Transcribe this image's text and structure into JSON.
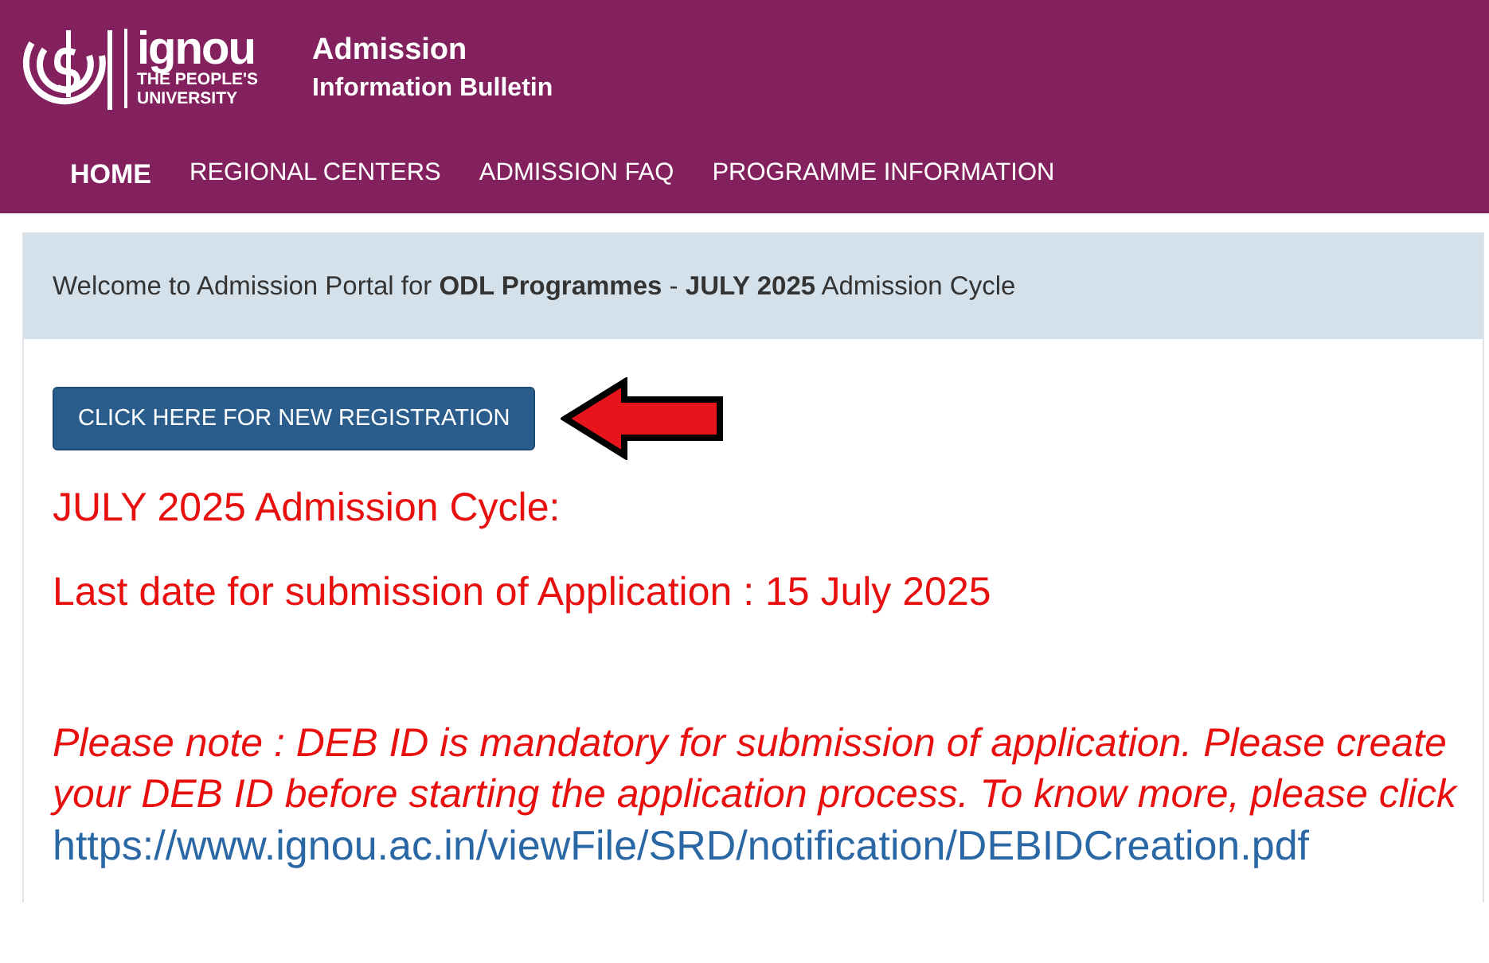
{
  "logo": {
    "name": "ignou",
    "tagline_1": "THE PEOPLE'S",
    "tagline_2": "UNIVERSITY"
  },
  "site_title": {
    "line_1": "Admission",
    "line_2": "Information Bulletin"
  },
  "nav": [
    {
      "label": "HOME",
      "selected": true
    },
    {
      "label": "REGIONAL CENTERS",
      "selected": false
    },
    {
      "label": "ADMISSION FAQ",
      "selected": false
    },
    {
      "label": "PROGRAMME INFORMATION",
      "selected": false
    }
  ],
  "welcome": "Welcome to Admission Portal for **ODL Programmes** - **JULY 2025** Admission Cycle",
  "register_button": "CLICK HERE FOR NEW REGISTRATION",
  "cycle_heading": "JULY 2025 Admission Cycle:",
  "last_date": "Last date for submission of Application : 15 July 2025",
  "note": "Please note : DEB ID is mandatory for submission of application. Please create your DEB ID before starting the application process. To know more, please click",
  "note_link": "https://www.ignou.ac.in/viewFile/SRD/notification/DEBIDCreation.pdf"
}
